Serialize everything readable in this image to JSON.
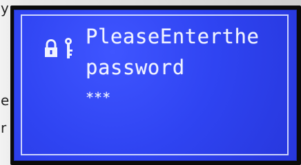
{
  "background_fragments": [
    "y",
    "e",
    "r"
  ],
  "display": {
    "line_1": "PleaseEnterthe",
    "line_2": "password",
    "password_mask": "***",
    "icons": [
      "lock-icon",
      "key-icon"
    ]
  },
  "colors": {
    "screen": "#2f44f2",
    "text": "#f0f3ff",
    "frame": "#0b0b0b"
  }
}
